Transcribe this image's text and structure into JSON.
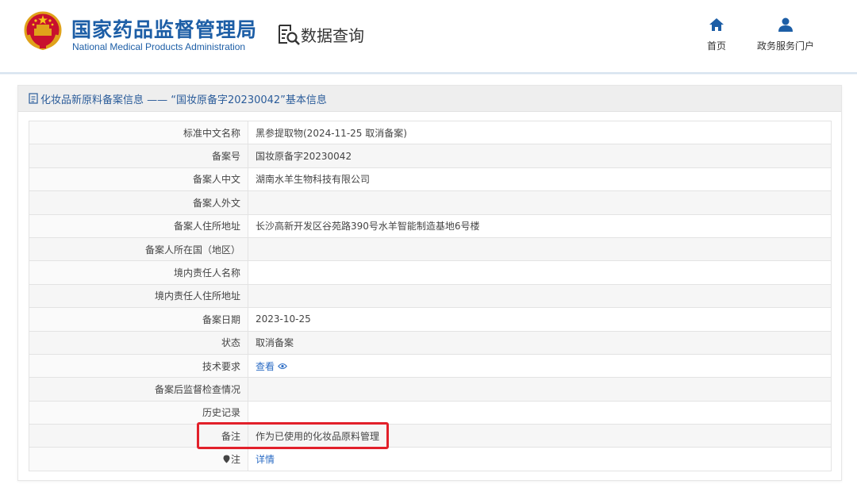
{
  "header": {
    "site_name_cn": "国家药品监督管理局",
    "site_name_en": "National Medical Products Administration",
    "query_title": "数据查询",
    "nav": [
      {
        "label": "首页",
        "icon": "home-icon"
      },
      {
        "label": "政务服务门户",
        "icon": "user-icon"
      }
    ]
  },
  "panel": {
    "title": "化妆品新原料备案信息 ——  “国妆原备字20230042”基本信息"
  },
  "table": {
    "rows": [
      {
        "key": "标准中文名称",
        "value": "黑参提取物(2024-11-25 取消备案)"
      },
      {
        "key": "备案号",
        "value": "国妆原备字20230042"
      },
      {
        "key": "备案人中文",
        "value": "湖南水羊生物科技有限公司"
      },
      {
        "key": "备案人外文",
        "value": ""
      },
      {
        "key": "备案人住所地址",
        "value": "长沙高新开发区谷苑路390号水羊智能制造基地6号楼"
      },
      {
        "key": "备案人所在国（地区）",
        "value": ""
      },
      {
        "key": "境内责任人名称",
        "value": ""
      },
      {
        "key": "境内责任人住所地址",
        "value": ""
      },
      {
        "key": "备案日期",
        "value": "2023-10-25"
      },
      {
        "key": "状态",
        "value": "取消备案"
      },
      {
        "key": "技术要求",
        "value": "查看"
      },
      {
        "key": "备案后监督检查情况",
        "value": ""
      },
      {
        "key": "历史记录",
        "value": ""
      },
      {
        "key": "备注",
        "value": "作为已使用的化妆品原料管理"
      },
      {
        "key": "注",
        "value": "详情"
      }
    ]
  },
  "colors": {
    "brand_blue": "#1d5ea6",
    "link_blue": "#2b6cc4",
    "highlight_red": "#e2202a"
  }
}
